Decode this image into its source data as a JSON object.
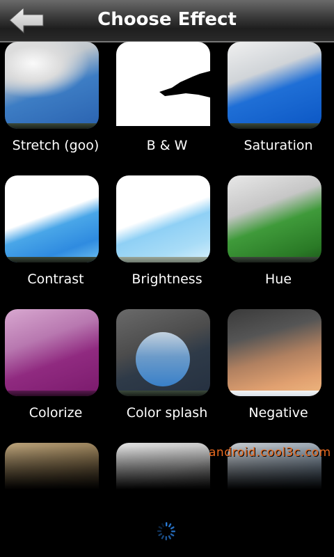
{
  "header": {
    "title": "Choose Effect",
    "back_icon": "back-arrow-icon"
  },
  "effects": [
    {
      "label": "Stretch (goo)"
    },
    {
      "label": "B & W"
    },
    {
      "label": "Saturation"
    },
    {
      "label": "Contrast"
    },
    {
      "label": "Brightness"
    },
    {
      "label": "Hue"
    },
    {
      "label": "Colorize"
    },
    {
      "label": "Color splash"
    },
    {
      "label": "Negative"
    },
    {
      "label": ""
    },
    {
      "label": ""
    },
    {
      "label": ""
    }
  ],
  "watermark": "android.cool3c.com",
  "loading_icon": "loading-spinner-icon",
  "colors": {
    "background": "#000000",
    "accent_spinner": "#2a7bd6",
    "watermark": "#e86a20"
  }
}
